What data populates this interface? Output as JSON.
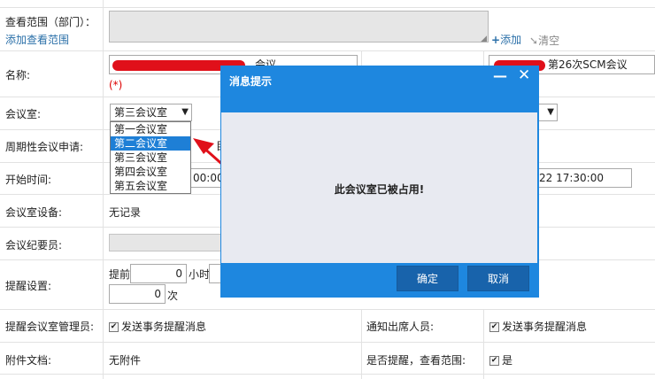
{
  "form": {
    "scope_label": "查看范围（部门）：",
    "add_scope_link": "添加查看范围",
    "add_label": "添加",
    "clear_label": "清空",
    "name_label": "名称:",
    "name_value_suffix": "会议",
    "required_mark": "(*)",
    "right_name_value": "第26次SCM会议",
    "room_label": "会议室:",
    "room_selected": "第三会议室",
    "room_options": [
      "第一会议室",
      "第二会议室",
      "第三会议室",
      "第四会议室",
      "第五会议室"
    ],
    "periodic_label": "周期性会议申请:",
    "periodic_fragment": "目",
    "start_label": "开始时间:",
    "start_value_fragment": "00:00",
    "end_value_fragment": "22 17:30:00",
    "equipment_label": "会议室设备:",
    "equipment_value": "无记录",
    "recorder_label": "会议纪要员:",
    "reminder_label": "提醒设置:",
    "reminder_before": "提前",
    "reminder_hours_value": "0",
    "reminder_hours_unit": "小时",
    "reminder_times_value": "0",
    "reminder_times_unit": "次",
    "admin_notify_label": "提醒会议室管理员:",
    "admin_notify_check": "发送事务提醒消息",
    "attendee_notify_label": "通知出席人员:",
    "attendee_notify_check": "发送事务提醒消息",
    "attachment_label": "附件文档:",
    "attachment_value": "无附件",
    "remind_scope_label": "是否提醒，查看范围:",
    "remind_scope_value": "是"
  },
  "modal": {
    "title": "消息提示",
    "message": "此会议室已被占用!",
    "ok_label": "确定",
    "cancel_label": "取消"
  },
  "colors": {
    "modal_header": "#1e87df",
    "modal_button": "#1863ab",
    "selected_option": "#1e7fd6",
    "annotation_arrow": "#e0101a"
  }
}
